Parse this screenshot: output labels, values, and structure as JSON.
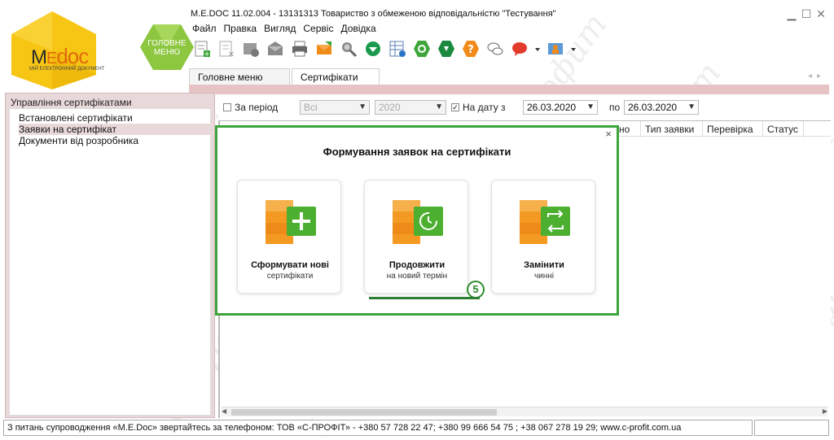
{
  "logo": {
    "brand_m": "M",
    "brand_e": "E",
    "brand_doc": "doc",
    "sub": "МІЙ ЕЛЕКТРОННИЙ ДОКУМЕНТ"
  },
  "main_menu_hex": {
    "line1": "ГОЛОВНЕ",
    "line2": "МЕНЮ"
  },
  "window": {
    "title": "M.E.DOC 11.02.004  - 13131313 Товариство з обмеженою відповідальністю \"Тестування\""
  },
  "menu": {
    "items": [
      "Файл",
      "Правка",
      "Вигляд",
      "Сервіс",
      "Довідка"
    ]
  },
  "toolbar": {
    "icons": [
      "new-document-icon",
      "delete-document-icon",
      "settings-gear-icon",
      "mail-icon",
      "printer-icon",
      "send-envelope-icon",
      "search-icon",
      "inbox-tray-icon",
      "calendar-grid-icon",
      "refresh-icon",
      "download-icon",
      "help-question-icon",
      "chat-bubbles-icon",
      "red-chat-icon",
      "dropdown-arrow-icon",
      "user-settings-icon"
    ]
  },
  "tabs": [
    {
      "label": "Головне меню"
    },
    {
      "label": "Сертифікати",
      "close": "✕"
    }
  ],
  "sidebar": {
    "title": "Управління сертифікатами",
    "items": [
      "Встановлені сертифікати",
      "Заявки на сертифікат",
      "Документи від розробника"
    ],
    "selected_index": 1
  },
  "filters": {
    "period_label": "За період",
    "period_checked": false,
    "period_select": "Всі",
    "year_select": "2020",
    "on_date_label": "На дату з",
    "on_date_checked": true,
    "date_from": "26.03.2020",
    "to_label": "по",
    "date_to": "26.03.2020"
  },
  "grid": {
    "columns": [
      "но",
      "Тип заявки",
      "Перевірка",
      "Статус"
    ]
  },
  "dialog": {
    "title": "Формування заявок на сертифікати",
    "close": "×",
    "cards": [
      {
        "line1": "Сформувати нові",
        "line2": "сертифікати",
        "icon": "plus-icon"
      },
      {
        "line1": "Продовжити",
        "line2": "на новий термін",
        "icon": "clock-renew-icon"
      },
      {
        "line1": "Замінити",
        "line2": "чинні",
        "icon": "swap-arrows-icon"
      }
    ],
    "step_badge": "5"
  },
  "statusbar": {
    "text": "З питань супроводження «M.E.Doc» звертайтесь за телефоном: ТОВ «С-ПРОФІТ» - +380 57 728 22 47; +380 99 666 54 75 ; +38 067 278 19 29; www.c-profit.com.ua"
  },
  "colors": {
    "accent_green": "#3ea53a",
    "sidebar_pink": "#e8d8d9",
    "logo_yellow": "#f5c20d",
    "hex_green": "#8dc63f",
    "orange": "#f08b1a"
  }
}
